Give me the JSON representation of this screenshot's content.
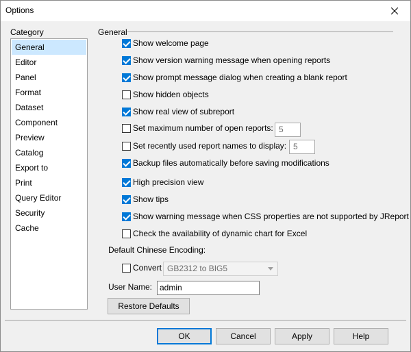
{
  "window": {
    "title": "Options"
  },
  "category": {
    "label": "Category",
    "selected": "General",
    "items": [
      "General",
      "Editor",
      "Panel",
      "Format",
      "Dataset",
      "Component",
      "Preview",
      "Catalog",
      "Export to",
      "Print",
      "Query Editor",
      "Security",
      "Cache"
    ]
  },
  "general": {
    "heading": "General",
    "options": [
      {
        "label": "Show welcome page",
        "checked": true
      },
      {
        "label": "Show version warning message when opening reports",
        "checked": true
      },
      {
        "label": "Show prompt message dialog when creating a blank report",
        "checked": true
      },
      {
        "label": "Show hidden objects",
        "checked": false
      },
      {
        "label": "Show real view of subreport",
        "checked": true
      },
      {
        "label": "Set maximum number of open reports:",
        "checked": false,
        "value": "5"
      },
      {
        "label": "Set recently used report names to display:",
        "checked": false,
        "value": "5"
      },
      {
        "label": "Backup files automatically before saving modifications",
        "checked": true
      },
      {
        "label": "High precision view",
        "checked": true
      },
      {
        "label": "Show tips",
        "checked": true
      },
      {
        "label": "Show warning message when CSS properties are not supported by JReport",
        "checked": true
      },
      {
        "label": "Check the availability of dynamic chart for Excel",
        "checked": false
      }
    ],
    "encoding": {
      "label": "Default Chinese Encoding:",
      "convert_label": "Convert",
      "convert_checked": false,
      "selected": "GB2312 to BIG5"
    },
    "user_name": {
      "label": "User Name:",
      "value": "admin"
    },
    "restore_label": "Restore Defaults"
  },
  "buttons": {
    "ok": "OK",
    "cancel": "Cancel",
    "apply": "Apply",
    "help": "Help"
  },
  "colors": {
    "accent": "#0078d7",
    "selection": "#cce8ff",
    "dialog_bg": "#f0f0f0"
  }
}
